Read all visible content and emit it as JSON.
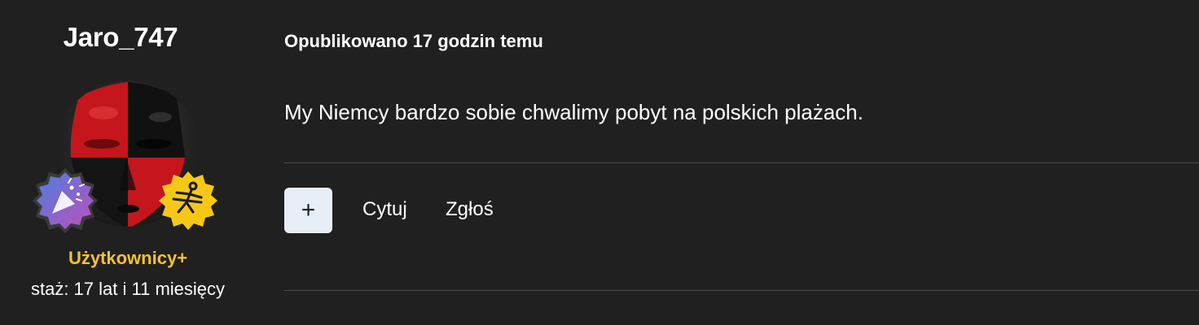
{
  "author": {
    "username": "Jaro_747",
    "avatar_icon": "red-black-mask-avatar",
    "badges": [
      {
        "icon": "party-popper-badge-icon",
        "color": "#8a5fd0"
      },
      {
        "icon": "dancer-star-badge-icon",
        "color": "#f5c818"
      }
    ],
    "group": "Użytkownicy+",
    "group_color": "#f5c233",
    "tenure": "staż: 17 lat i 11 miesięcy"
  },
  "post": {
    "posted_label": "Opublikowano 17 godzin temu",
    "message": "My Niemcy bardzo sobie chwalimy pobyt na polskich plażach."
  },
  "actions": {
    "plus_label": "+",
    "quote_label": "Cytuj",
    "report_label": "Zgłoś"
  },
  "colors": {
    "background": "#202020",
    "divider": "#4a4a4a",
    "plus_button_bg": "#e8eef6"
  }
}
